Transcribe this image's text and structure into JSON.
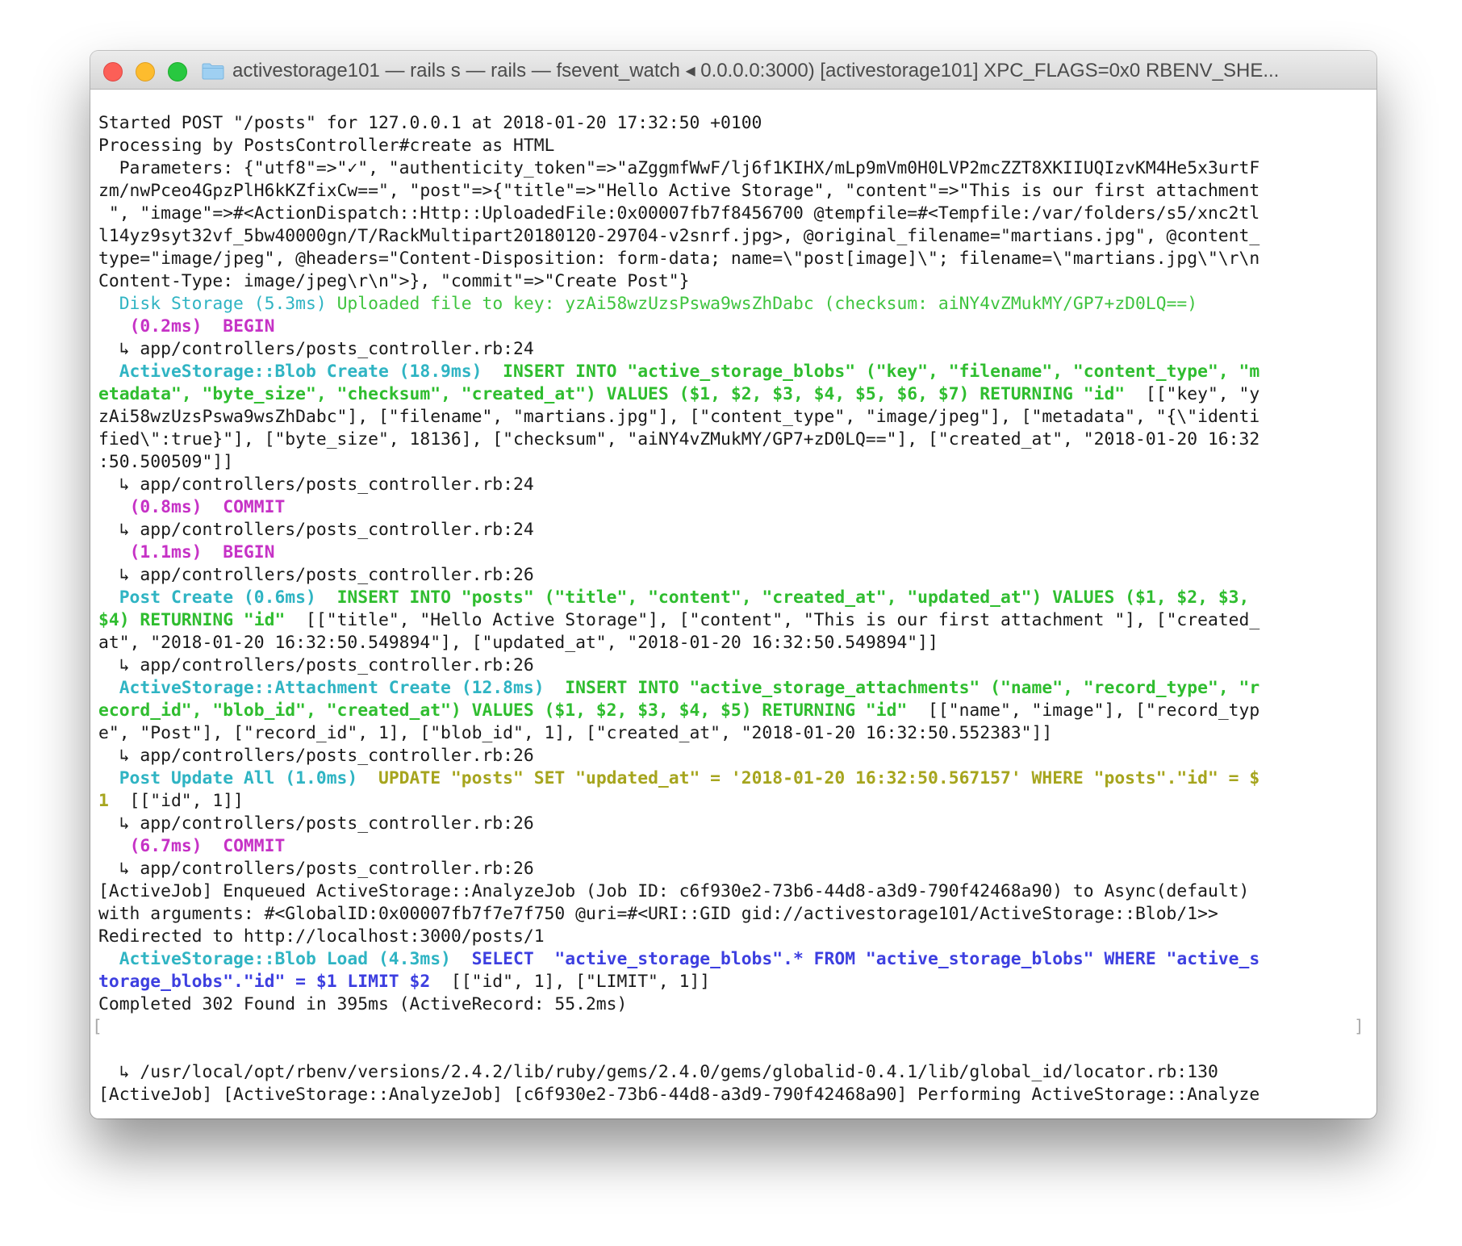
{
  "window": {
    "title": "activestorage101 — rails s — rails — fsevent_watch ◂ 0.0.0.0:3000) [activestorage101] XPC_FLAGS=0x0 RBENV_SHE..."
  },
  "colors": {
    "cyan": "#2fb4c3",
    "green": "#2fbd2f",
    "magenta": "#c632c6",
    "olive": "#a6a51e",
    "blue": "#3d3fe0",
    "text": "#1a1a1a"
  },
  "terminal": {
    "lines": [
      [
        {
          "t": "Started POST \"/posts\" for 127.0.0.1 at 2018-01-20 17:32:50 +0100",
          "c": "plain"
        }
      ],
      [
        {
          "t": "Processing by PostsController#create as HTML",
          "c": "plain"
        }
      ],
      [
        {
          "t": "  Parameters: {\"utf8\"=>\"✓\", \"authenticity_token\"=>\"aZggmfWwF/lj6f1KIHX/mLp9mVm0H0LVP2mcZZT8XKIIUQIzvKM4He5x3urtF",
          "c": "plain"
        }
      ],
      [
        {
          "t": "zm/nwPceo4GpzPlH6kKZfixCw==\", \"post\"=>{\"title\"=>\"Hello Active Storage\", \"content\"=>\"This is our first attachment",
          "c": "plain"
        }
      ],
      [
        {
          "t": " \", \"image\"=>#<ActionDispatch::Http::UploadedFile:0x00007fb7f8456700 @tempfile=#<Tempfile:/var/folders/s5/xnc2tl",
          "c": "plain"
        }
      ],
      [
        {
          "t": "l14yz9syt32vf_5bw40000gn/T/RackMultipart20180120-29704-v2snrf.jpg>, @original_filename=\"martians.jpg\", @content_",
          "c": "plain"
        }
      ],
      [
        {
          "t": "type=\"image/jpeg\", @headers=\"Content-Disposition: form-data; name=\\\"post[image]\\\"; filename=\\\"martians.jpg\\\"\\r\\n",
          "c": "plain"
        }
      ],
      [
        {
          "t": "Content-Type: image/jpeg\\r\\n\">}, \"commit\"=>\"Create Post\"}",
          "c": "plain"
        }
      ],
      [
        {
          "t": "  ",
          "c": "plain"
        },
        {
          "t": "Disk Storage (5.3ms)",
          "c": "cyan-n"
        },
        {
          "t": " Uploaded file to key: yzAi58wzUzsPswa9wsZhDabc (checksum: aiNY4vZMukMY/GP7+zD0LQ==)",
          "c": "green-n"
        }
      ],
      [
        {
          "t": "   ",
          "c": "plain"
        },
        {
          "t": "(0.2ms)  BEGIN",
          "c": "magenta"
        }
      ],
      [
        {
          "t": "  ↳ app/controllers/posts_controller.rb:24",
          "c": "plain"
        }
      ],
      [
        {
          "t": "  ",
          "c": "plain"
        },
        {
          "t": "ActiveStorage::Blob Create (18.9ms)",
          "c": "cyan"
        },
        {
          "t": "  ",
          "c": "plain"
        },
        {
          "t": "INSERT INTO \"active_storage_blobs\" (\"key\", \"filename\", \"content_type\", \"m",
          "c": "green"
        }
      ],
      [
        {
          "t": "etadata\", \"byte_size\", \"checksum\", \"created_at\") VALUES ($1, $2, $3, $4, $5, $6, $7) RETURNING \"id\"",
          "c": "green"
        },
        {
          "t": "  [[\"key\", \"y",
          "c": "plain"
        }
      ],
      [
        {
          "t": "zAi58wzUzsPswa9wsZhDabc\"], [\"filename\", \"martians.jpg\"], [\"content_type\", \"image/jpeg\"], [\"metadata\", \"{\\\"identi",
          "c": "plain"
        }
      ],
      [
        {
          "t": "fied\\\":true}\"], [\"byte_size\", 18136], [\"checksum\", \"aiNY4vZMukMY/GP7+zD0LQ==\"], [\"created_at\", \"2018-01-20 16:32",
          "c": "plain"
        }
      ],
      [
        {
          "t": ":50.500509\"]]",
          "c": "plain"
        }
      ],
      [
        {
          "t": "  ↳ app/controllers/posts_controller.rb:24",
          "c": "plain"
        }
      ],
      [
        {
          "t": "   ",
          "c": "plain"
        },
        {
          "t": "(0.8ms)  COMMIT",
          "c": "magenta"
        }
      ],
      [
        {
          "t": "  ↳ app/controllers/posts_controller.rb:24",
          "c": "plain"
        }
      ],
      [
        {
          "t": "   ",
          "c": "plain"
        },
        {
          "t": "(1.1ms)  BEGIN",
          "c": "magenta"
        }
      ],
      [
        {
          "t": "  ↳ app/controllers/posts_controller.rb:26",
          "c": "plain"
        }
      ],
      [
        {
          "t": "  ",
          "c": "plain"
        },
        {
          "t": "Post Create (0.6ms)",
          "c": "cyan"
        },
        {
          "t": "  ",
          "c": "plain"
        },
        {
          "t": "INSERT INTO \"posts\" (\"title\", \"content\", \"created_at\", \"updated_at\") VALUES ($1, $2, $3,",
          "c": "green"
        }
      ],
      [
        {
          "t": "$4) RETURNING \"id\"",
          "c": "green"
        },
        {
          "t": "  [[\"title\", \"Hello Active Storage\"], [\"content\", \"This is our first attachment \"], [\"created_",
          "c": "plain"
        }
      ],
      [
        {
          "t": "at\", \"2018-01-20 16:32:50.549894\"], [\"updated_at\", \"2018-01-20 16:32:50.549894\"]]",
          "c": "plain"
        }
      ],
      [
        {
          "t": "  ↳ app/controllers/posts_controller.rb:26",
          "c": "plain"
        }
      ],
      [
        {
          "t": "  ",
          "c": "plain"
        },
        {
          "t": "ActiveStorage::Attachment Create (12.8ms)",
          "c": "cyan"
        },
        {
          "t": "  ",
          "c": "plain"
        },
        {
          "t": "INSERT INTO \"active_storage_attachments\" (\"name\", \"record_type\", \"r",
          "c": "green"
        }
      ],
      [
        {
          "t": "ecord_id\", \"blob_id\", \"created_at\") VALUES ($1, $2, $3, $4, $5) RETURNING \"id\"",
          "c": "green"
        },
        {
          "t": "  [[\"name\", \"image\"], [\"record_typ",
          "c": "plain"
        }
      ],
      [
        {
          "t": "e\", \"Post\"], [\"record_id\", 1], [\"blob_id\", 1], [\"created_at\", \"2018-01-20 16:32:50.552383\"]]",
          "c": "plain"
        }
      ],
      [
        {
          "t": "  ↳ app/controllers/posts_controller.rb:26",
          "c": "plain"
        }
      ],
      [
        {
          "t": "  ",
          "c": "plain"
        },
        {
          "t": "Post Update All (1.0ms)",
          "c": "cyan"
        },
        {
          "t": "  ",
          "c": "plain"
        },
        {
          "t": "UPDATE \"posts\" SET \"updated_at\" = '2018-01-20 16:32:50.567157' WHERE \"posts\".\"id\" = $",
          "c": "olive"
        }
      ],
      [
        {
          "t": "1",
          "c": "olive"
        },
        {
          "t": "  [[\"id\", 1]]",
          "c": "plain"
        }
      ],
      [
        {
          "t": "  ↳ app/controllers/posts_controller.rb:26",
          "c": "plain"
        }
      ],
      [
        {
          "t": "   ",
          "c": "plain"
        },
        {
          "t": "(6.7ms)  COMMIT",
          "c": "magenta"
        }
      ],
      [
        {
          "t": "  ↳ app/controllers/posts_controller.rb:26",
          "c": "plain"
        }
      ],
      [
        {
          "t": "[ActiveJob] Enqueued ActiveStorage::AnalyzeJob (Job ID: c6f930e2-73b6-44d8-a3d9-790f42468a90) to Async(default)",
          "c": "plain"
        }
      ],
      [
        {
          "t": "with arguments: #<GlobalID:0x00007fb7f7e7f750 @uri=#<URI::GID gid://activestorage101/ActiveStorage::Blob/1>>",
          "c": "plain"
        }
      ],
      [
        {
          "t": "Redirected to http://localhost:3000/posts/1",
          "c": "plain"
        }
      ],
      [
        {
          "t": "  ",
          "c": "plain"
        },
        {
          "t": "ActiveStorage::Blob Load (4.3ms)",
          "c": "cyan"
        },
        {
          "t": "  ",
          "c": "plain"
        },
        {
          "t": "SELECT  \"active_storage_blobs\".* FROM \"active_storage_blobs\" WHERE \"active_s",
          "c": "blue"
        }
      ],
      [
        {
          "t": "torage_blobs\".\"id\" = $1 LIMIT $2",
          "c": "blue"
        },
        {
          "t": "  [[\"id\", 1], [\"LIMIT\", 1]]",
          "c": "plain"
        }
      ],
      [
        {
          "t": "Completed 302 Found in 395ms (ActiveRecord: 55.2ms)",
          "c": "plain"
        }
      ]
    ],
    "separator": {
      "left": "[",
      "right": "]"
    },
    "after_lines": [
      [
        {
          "t": "",
          "c": "plain"
        }
      ],
      [
        {
          "t": "  ↳ /usr/local/opt/rbenv/versions/2.4.2/lib/ruby/gems/2.4.0/gems/globalid-0.4.1/lib/global_id/locator.rb:130",
          "c": "plain"
        }
      ],
      [
        {
          "t": "[ActiveJob] [ActiveStorage::AnalyzeJob] [c6f930e2-73b6-44d8-a3d9-790f42468a90] Performing ActiveStorage::Analyze",
          "c": "plain"
        }
      ]
    ]
  }
}
